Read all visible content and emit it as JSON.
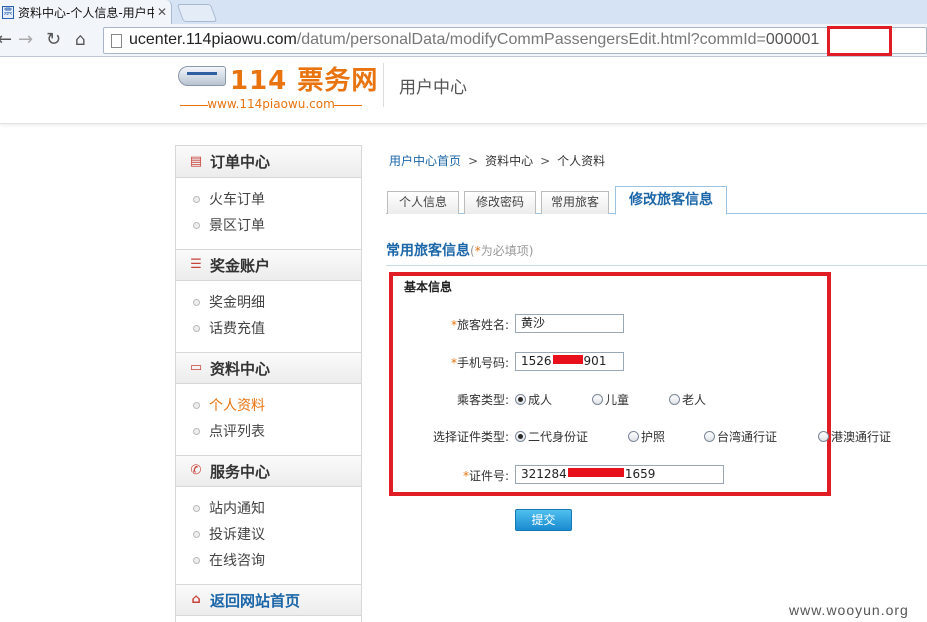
{
  "browser": {
    "tab_title": "资料中心-个人信息-用户中",
    "url_host": "ucenter.114piaowu.com",
    "url_path": "/datum/personalData/modifyCommPassengersEdit.html?commId=",
    "url_param": "000001",
    "colors": {
      "highlight": "#e01c24"
    }
  },
  "header": {
    "logo_text": "114 票务网",
    "logo_sub": "www.114piaowu.com",
    "title": "用户中心"
  },
  "sidebar": {
    "sections": [
      {
        "title": "订单中心",
        "icon": "receipt-icon",
        "items": [
          "火车订单",
          "景区订单"
        ]
      },
      {
        "title": "奖金账户",
        "icon": "coins-icon",
        "items": [
          "奖金明细",
          "话费充值"
        ]
      },
      {
        "title": "资料中心",
        "icon": "folder-icon",
        "items": [
          "个人资料",
          "点评列表"
        ],
        "active_item": "个人资料"
      },
      {
        "title": "服务中心",
        "icon": "phone-icon",
        "items": [
          "站内通知",
          "投诉建议",
          "在线咨询"
        ]
      },
      {
        "title": "返回网站首页",
        "icon": "home-icon",
        "items": []
      }
    ]
  },
  "breadcrumb": {
    "home": "用户中心首页",
    "level2": "资料中心",
    "level3": "个人资料",
    "sep": ">"
  },
  "tabs": {
    "personal_info": "个人信息",
    "change_password": "修改密码",
    "frequent_passengers": "常用旅客",
    "edit_passenger": "修改旅客信息",
    "active": "修改旅客信息"
  },
  "section": {
    "title": "常用旅客信息",
    "req_open": "(",
    "req_star": "*",
    "req_text": "为必填项)"
  },
  "form": {
    "group_title": "基本信息",
    "name_label": "旅客姓名:",
    "name_value": "黄沙",
    "phone_label": "手机号码:",
    "phone_prefix": "1526",
    "phone_suffix": "901",
    "passenger_type_label": "乘客类型:",
    "passenger_types": [
      "成人",
      "儿童",
      "老人"
    ],
    "passenger_type_selected": "成人",
    "id_type_label": "选择证件类型:",
    "id_types": [
      "二代身份证",
      "护照",
      "台湾通行证",
      "港澳通行证"
    ],
    "id_type_selected": "二代身份证",
    "id_number_label": "证件号:",
    "id_number_prefix": "321284",
    "id_number_suffix": "1659",
    "star": "*",
    "submit_label": "提交"
  },
  "watermark": "www.wooyun.org"
}
